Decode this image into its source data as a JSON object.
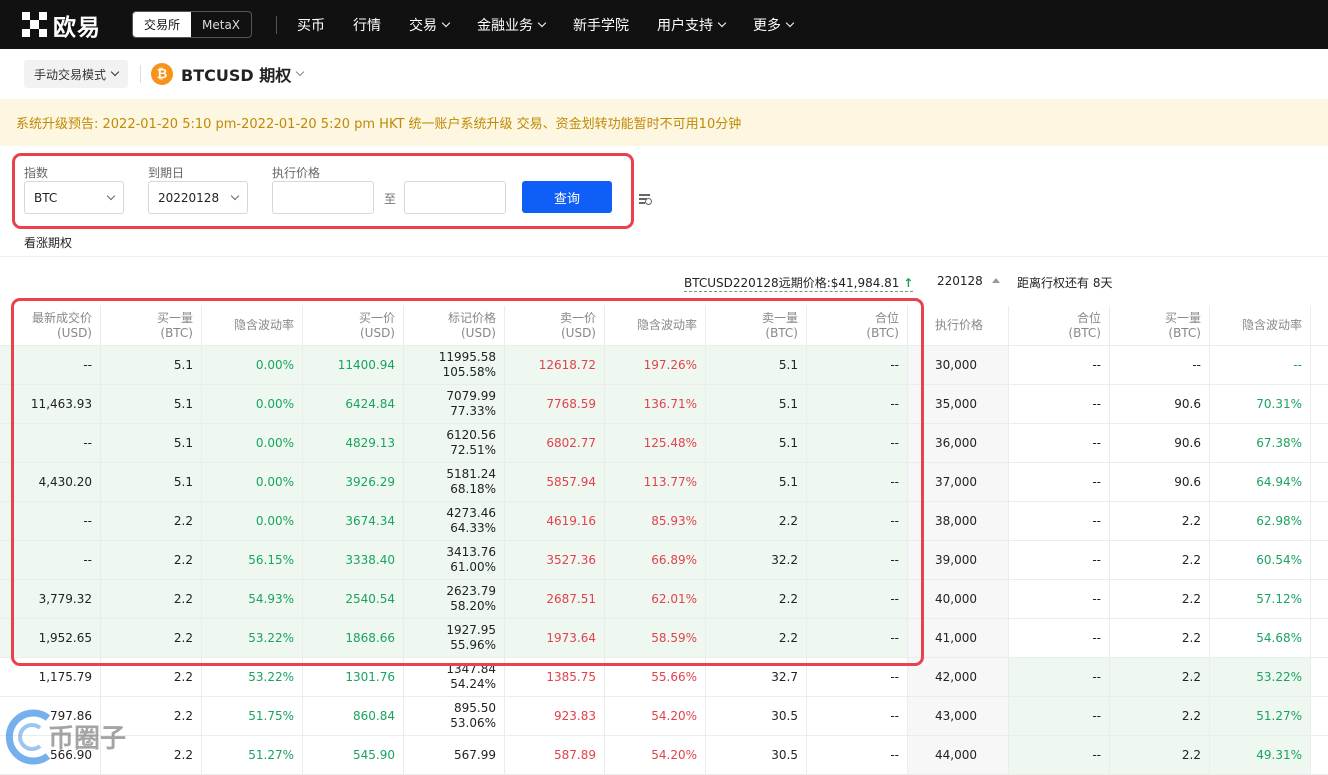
{
  "nav": {
    "brand": "欧易",
    "seg": [
      "交易所",
      "MetaX"
    ],
    "items": [
      {
        "label": "买币",
        "dropdown": false
      },
      {
        "label": "行情",
        "dropdown": false
      },
      {
        "label": "交易",
        "dropdown": true
      },
      {
        "label": "金融业务",
        "dropdown": true
      },
      {
        "label": "新手学院",
        "dropdown": false
      },
      {
        "label": "用户支持",
        "dropdown": true
      },
      {
        "label": "更多",
        "dropdown": true
      }
    ]
  },
  "sub": {
    "mode": "手动交易模式",
    "coin_icon": "₿",
    "pair": "BTCUSD 期权"
  },
  "banner": "系统升级预告: 2022-01-20 5:10 pm-2022-01-20 5:20 pm HKT 统一账户系统升级 交易、资金划转功能暂时不可用10分钟",
  "filter": {
    "index_label": "指数",
    "index_value": "BTC",
    "expiry_label": "到期日",
    "expiry_value": "20220128",
    "strike_label": "执行价格",
    "to": "至",
    "query": "查询",
    "calls_label": "看涨期权"
  },
  "info": {
    "forward": "BTCUSD220128远期价格:$41,984.81",
    "up_arrow": "↑",
    "expiry": "220128",
    "countdown": "距离行权还有 8天"
  },
  "table": {
    "headers": [
      [
        "最新成交价",
        "(USD)"
      ],
      [
        "买一量",
        "(BTC)"
      ],
      [
        "隐含波动率",
        ""
      ],
      [
        "买一价",
        "(USD)"
      ],
      [
        "标记价格",
        "(USD)"
      ],
      [
        "卖一价",
        "(USD)"
      ],
      [
        "隐含波动率",
        ""
      ],
      [
        "卖一量",
        "(BTC)"
      ],
      [
        "合位",
        "(BTC)"
      ],
      [
        "执行价格",
        ""
      ],
      [
        "合位",
        "(BTC)"
      ],
      [
        "买一量",
        "(BTC)"
      ],
      [
        "隐含波动率",
        ""
      ]
    ],
    "rows": [
      {
        "last": "--",
        "bidsz": "5.1",
        "iv": "0.00%",
        "bid": "11400.94",
        "mark": "11995.58",
        "markiv": "105.58%",
        "ask": "12618.72",
        "askiv": "197.26%",
        "asksz": "5.1",
        "pos": "--",
        "strike": "30,000",
        "ppos": "--",
        "pbidsz": "--",
        "piv": "--"
      },
      {
        "last": "11,463.93",
        "bidsz": "5.1",
        "iv": "0.00%",
        "bid": "6424.84",
        "mark": "7079.99",
        "markiv": "77.33%",
        "ask": "7768.59",
        "askiv": "136.71%",
        "asksz": "5.1",
        "pos": "--",
        "strike": "35,000",
        "ppos": "--",
        "pbidsz": "90.6",
        "piv": "70.31%"
      },
      {
        "last": "--",
        "bidsz": "5.1",
        "iv": "0.00%",
        "bid": "4829.13",
        "mark": "6120.56",
        "markiv": "72.51%",
        "ask": "6802.77",
        "askiv": "125.48%",
        "asksz": "5.1",
        "pos": "--",
        "strike": "36,000",
        "ppos": "--",
        "pbidsz": "90.6",
        "piv": "67.38%"
      },
      {
        "last": "4,430.20",
        "bidsz": "5.1",
        "iv": "0.00%",
        "bid": "3926.29",
        "mark": "5181.24",
        "markiv": "68.18%",
        "ask": "5857.94",
        "askiv": "113.77%",
        "asksz": "5.1",
        "pos": "--",
        "strike": "37,000",
        "ppos": "--",
        "pbidsz": "90.6",
        "piv": "64.94%"
      },
      {
        "last": "--",
        "bidsz": "2.2",
        "iv": "0.00%",
        "bid": "3674.34",
        "mark": "4273.46",
        "markiv": "64.33%",
        "ask": "4619.16",
        "askiv": "85.93%",
        "asksz": "2.2",
        "pos": "--",
        "strike": "38,000",
        "ppos": "--",
        "pbidsz": "2.2",
        "piv": "62.98%"
      },
      {
        "last": "--",
        "bidsz": "2.2",
        "iv": "56.15%",
        "bid": "3338.40",
        "mark": "3413.76",
        "markiv": "61.00%",
        "ask": "3527.36",
        "askiv": "66.89%",
        "asksz": "32.2",
        "pos": "--",
        "strike": "39,000",
        "ppos": "--",
        "pbidsz": "2.2",
        "piv": "60.54%"
      },
      {
        "last": "3,779.32",
        "bidsz": "2.2",
        "iv": "54.93%",
        "bid": "2540.54",
        "mark": "2623.79",
        "markiv": "58.20%",
        "ask": "2687.51",
        "askiv": "62.01%",
        "asksz": "2.2",
        "pos": "--",
        "strike": "40,000",
        "ppos": "--",
        "pbidsz": "2.2",
        "piv": "57.12%"
      },
      {
        "last": "1,952.65",
        "bidsz": "2.2",
        "iv": "53.22%",
        "bid": "1868.66",
        "mark": "1927.95",
        "markiv": "55.96%",
        "ask": "1973.64",
        "askiv": "58.59%",
        "asksz": "2.2",
        "pos": "--",
        "strike": "41,000",
        "ppos": "--",
        "pbidsz": "2.2",
        "piv": "54.68%"
      },
      {
        "last": "1,175.79",
        "bidsz": "2.2",
        "iv": "53.22%",
        "bid": "1301.76",
        "mark": "1347.84",
        "markiv": "54.24%",
        "ask": "1385.75",
        "askiv": "55.66%",
        "asksz": "32.7",
        "pos": "--",
        "strike": "42,000",
        "ppos": "--",
        "pbidsz": "2.2",
        "piv": "53.22%"
      },
      {
        "last": "797.86",
        "bidsz": "2.2",
        "iv": "51.75%",
        "bid": "860.84",
        "mark": "895.50",
        "markiv": "53.06%",
        "ask": "923.83",
        "askiv": "54.20%",
        "asksz": "30.5",
        "pos": "--",
        "strike": "43,000",
        "ppos": "--",
        "pbidsz": "2.2",
        "piv": "51.27%"
      },
      {
        "last": "566.90",
        "bidsz": "2.2",
        "iv": "51.27%",
        "bid": "545.90",
        "mark": "567.99",
        "markiv": "",
        "ask": "587.89",
        "askiv": "54.20%",
        "asksz": "30.5",
        "pos": "--",
        "strike": "44,000",
        "ppos": "--",
        "pbidsz": "2.2",
        "piv": "49.31%"
      }
    ]
  },
  "watermark": "币圈子",
  "colors": {
    "green": "#1aa35f",
    "red": "#e1424d",
    "query_button": "#0f5ef7",
    "highlight": "#e9424d",
    "banner_text": "#c08a06",
    "itm_bg": "#eef8f1"
  }
}
